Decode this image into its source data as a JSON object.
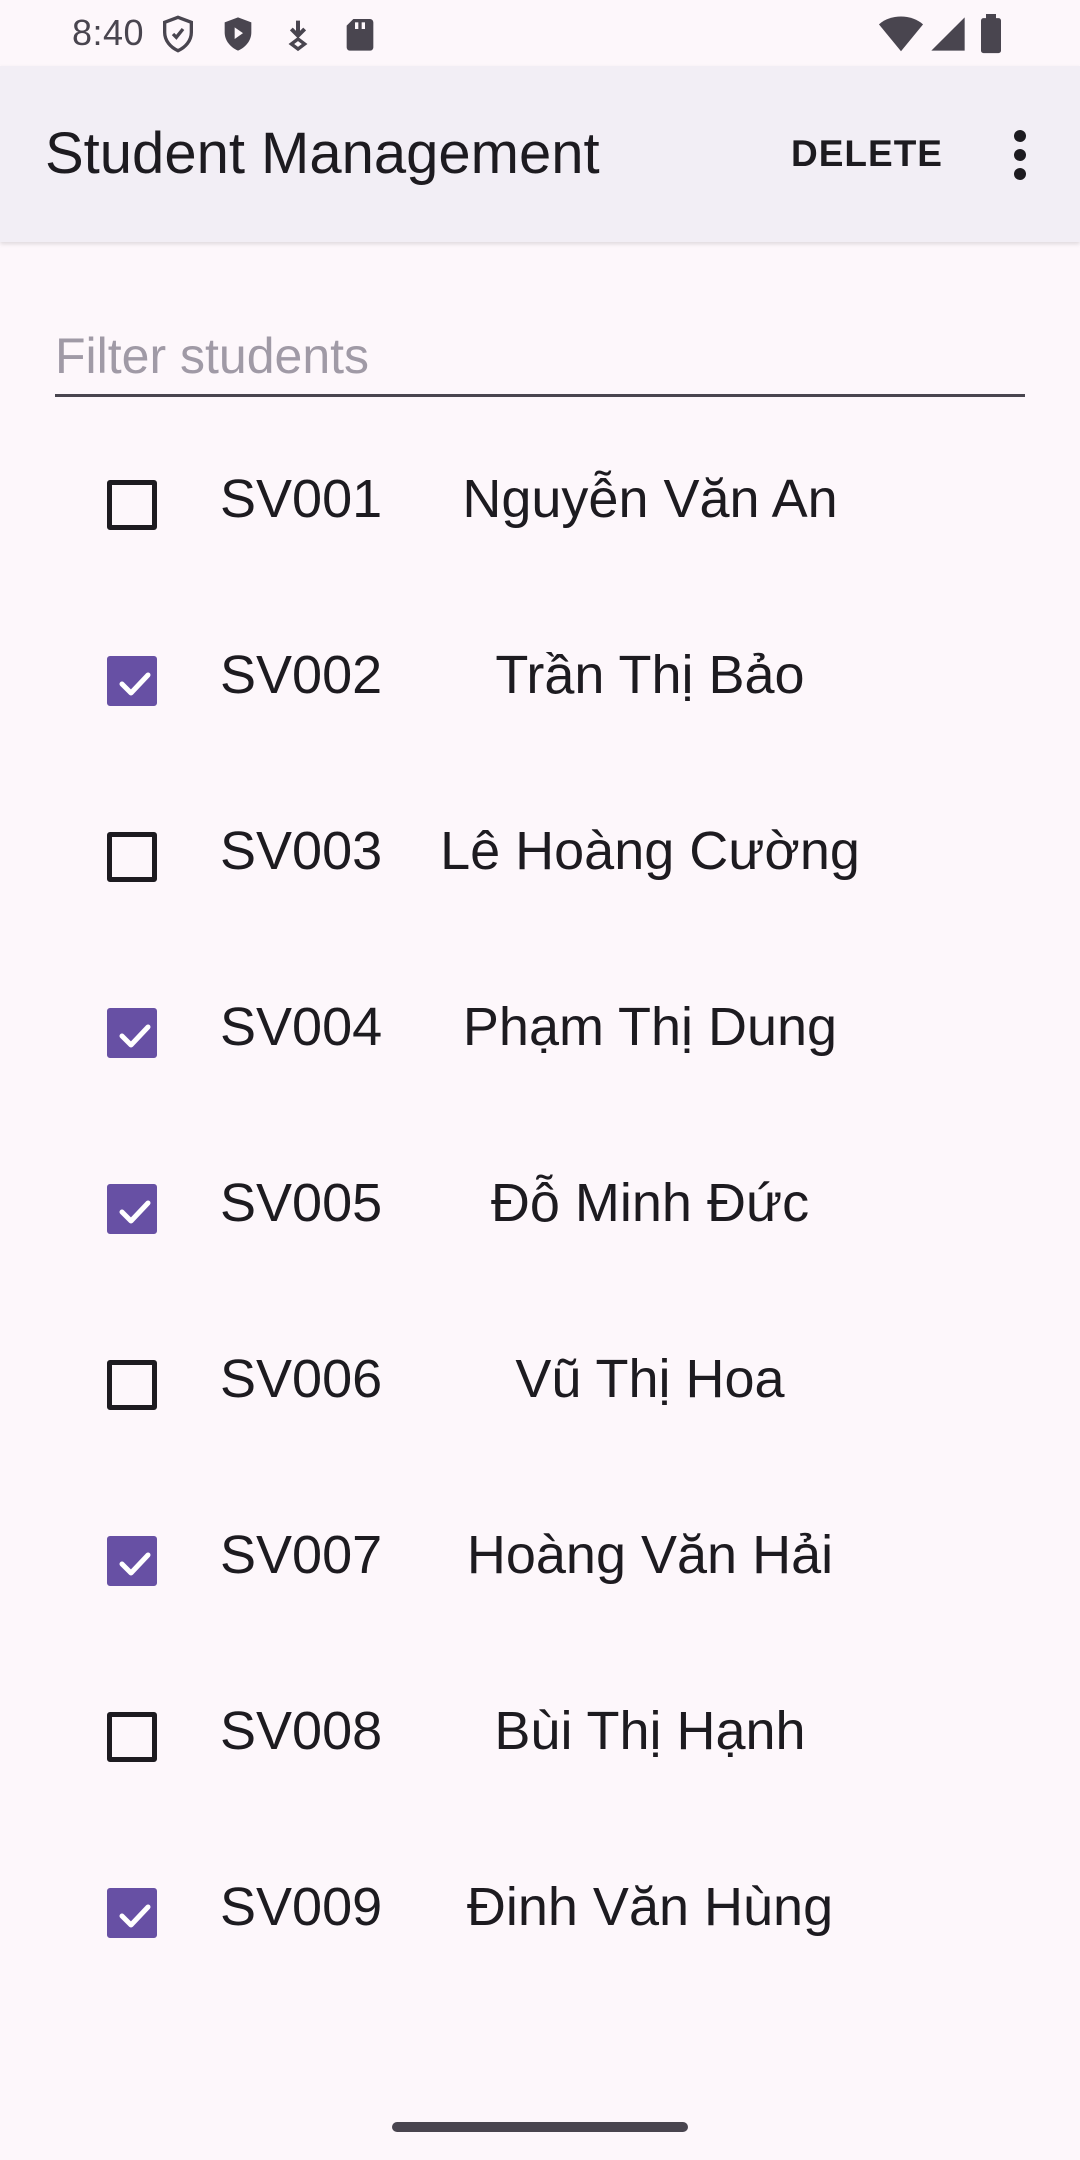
{
  "status_bar": {
    "time": "8:40",
    "icons_left": [
      "shield-outline-icon",
      "shield-play-icon",
      "download-icon",
      "sd-card-icon"
    ],
    "icons_right": [
      "wifi-icon",
      "signal-icon",
      "battery-icon"
    ]
  },
  "app_bar": {
    "title": "Student Management",
    "delete_label": "DELETE",
    "overflow_icon": "more-vert-icon"
  },
  "filter": {
    "placeholder": "Filter students",
    "value": ""
  },
  "students": [
    {
      "id": "SV001",
      "name": "Nguyễn Văn An",
      "checked": false
    },
    {
      "id": "SV002",
      "name": "Trần Thị Bảo",
      "checked": true
    },
    {
      "id": "SV003",
      "name": "Lê Hoàng Cường",
      "checked": false
    },
    {
      "id": "SV004",
      "name": "Phạm Thị Dung",
      "checked": true
    },
    {
      "id": "SV005",
      "name": "Đỗ Minh Đức",
      "checked": true
    },
    {
      "id": "SV006",
      "name": "Vũ Thị Hoa",
      "checked": false
    },
    {
      "id": "SV007",
      "name": "Hoàng Văn Hải",
      "checked": true
    },
    {
      "id": "SV008",
      "name": "Bùi Thị Hạnh",
      "checked": false
    },
    {
      "id": "SV009",
      "name": "Đinh Văn Hùng",
      "checked": true
    }
  ],
  "colors": {
    "accent": "#6750a4",
    "background": "#fdf7fb",
    "app_bar": "#f2eef5",
    "text": "#1d1b20"
  }
}
